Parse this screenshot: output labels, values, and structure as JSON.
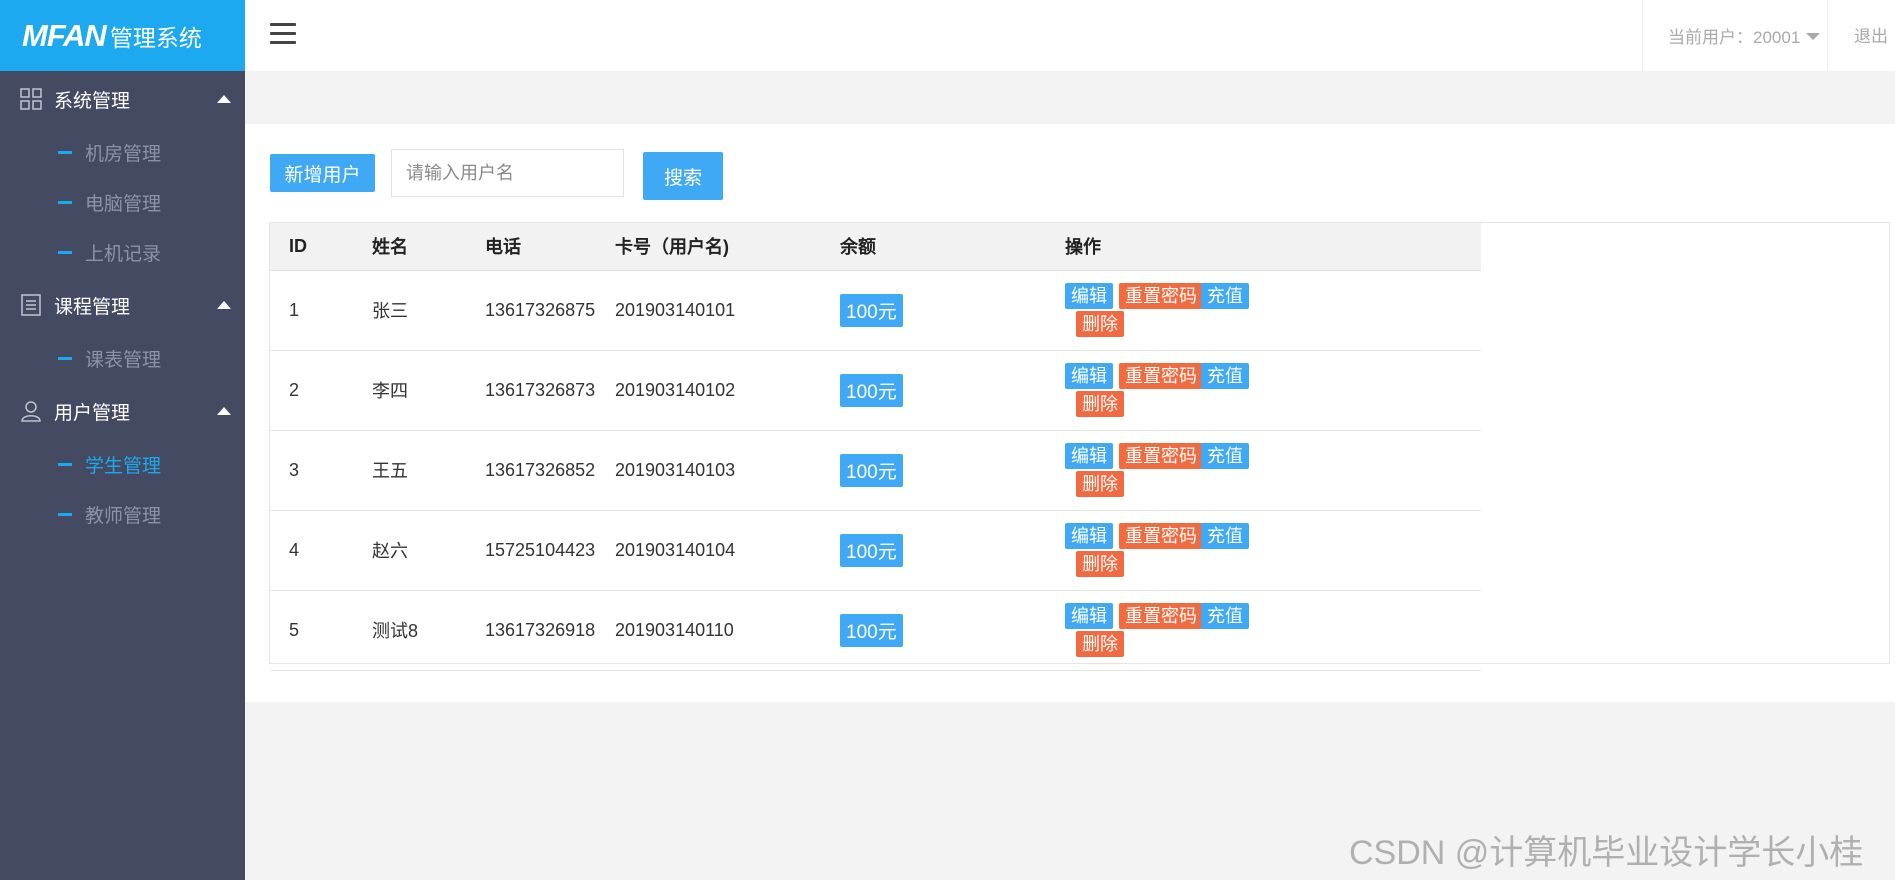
{
  "logo": {
    "brand": "MFAN",
    "title": "管理系统"
  },
  "sidebar": {
    "groups": [
      {
        "label": "系统管理",
        "icon": "grid-icon",
        "items": [
          {
            "label": "机房管理"
          },
          {
            "label": "电脑管理"
          },
          {
            "label": "上机记录"
          }
        ]
      },
      {
        "label": "课程管理",
        "icon": "list-doc-icon",
        "items": [
          {
            "label": "课表管理"
          }
        ]
      },
      {
        "label": "用户管理",
        "icon": "user-icon",
        "items": [
          {
            "label": "学生管理",
            "active": true
          },
          {
            "label": "教师管理"
          }
        ]
      }
    ]
  },
  "header": {
    "current_user": "当前用户：20001",
    "logout": "退出"
  },
  "toolbar": {
    "add_label": "新增用户",
    "search_placeholder": "请输入用户名",
    "search_label": "搜索"
  },
  "table": {
    "columns": [
      "ID",
      "姓名",
      "电话",
      "卡号（用户名)",
      "余额",
      "操作"
    ],
    "rows": [
      {
        "id": "1",
        "name": "张三",
        "phone": "13617326875",
        "card": "201903140101",
        "balance": "100元"
      },
      {
        "id": "2",
        "name": "李四",
        "phone": "13617326873",
        "card": "201903140102",
        "balance": "100元"
      },
      {
        "id": "3",
        "name": "王五",
        "phone": "13617326852",
        "card": "201903140103",
        "balance": "100元"
      },
      {
        "id": "4",
        "name": "赵六",
        "phone": "15725104423",
        "card": "201903140104",
        "balance": "100元"
      },
      {
        "id": "5",
        "name": "测试8",
        "phone": "13617326918",
        "card": "201903140110",
        "balance": "100元"
      }
    ],
    "actions": {
      "edit": "编辑",
      "reset": "重置密码",
      "charge": "充值",
      "delete": "删除"
    }
  },
  "watermark": "CSDN @计算机毕业设计学长小桂",
  "colors": {
    "accent": "#1ca9ef",
    "button": "#3fa9f5",
    "danger": "#f26a3f",
    "sidebar": "#434a62"
  }
}
